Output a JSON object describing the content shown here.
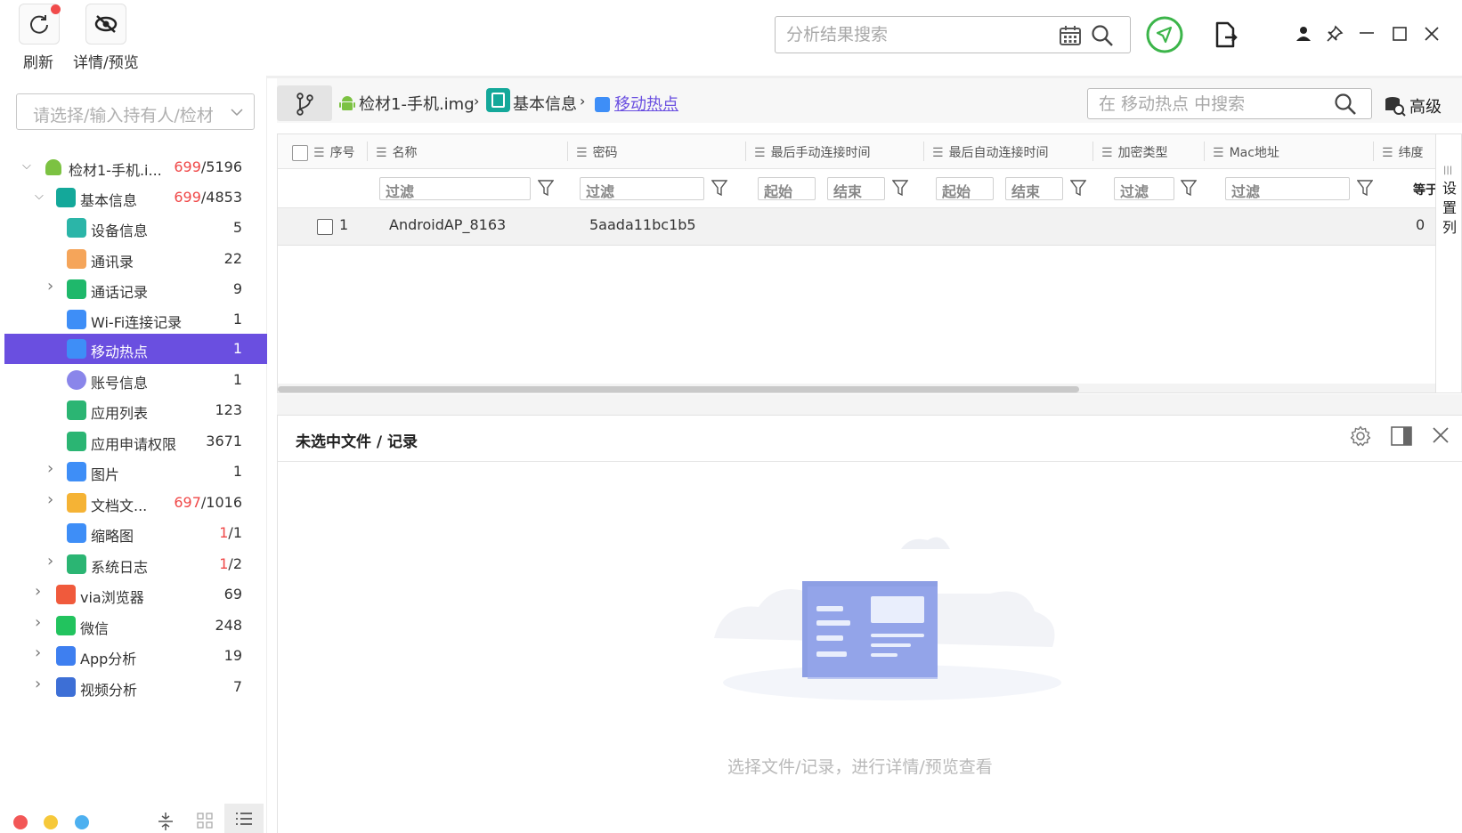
{
  "toolbar": {
    "refresh_label": "刷新",
    "detail_preview_label": "详情/预览",
    "search_placeholder": "分析结果搜索"
  },
  "left_panel": {
    "owner_placeholder": "请选择/输入持有人/检材",
    "tree": [
      {
        "label": "检材1-手机.i...",
        "count_red": "699",
        "count_rest": "/5196",
        "icon": "android-icon"
      },
      {
        "label": "基本信息",
        "count_red": "699",
        "count_rest": "/4853",
        "icon": "info-icon"
      },
      {
        "label": "设备信息",
        "count": "5",
        "icon": "device-icon"
      },
      {
        "label": "通讯录",
        "count": "22",
        "icon": "contacts-icon"
      },
      {
        "label": "通话记录",
        "count": "9",
        "icon": "phone-icon"
      },
      {
        "label": "Wi-Fi连接记录",
        "count": "1",
        "icon": "wifi-icon"
      },
      {
        "label": "移动热点",
        "count": "1",
        "icon": "hotspot-icon"
      },
      {
        "label": "账号信息",
        "count": "1",
        "icon": "account-icon"
      },
      {
        "label": "应用列表",
        "count": "123",
        "icon": "list-icon"
      },
      {
        "label": "应用申请权限",
        "count": "3671",
        "icon": "list-icon"
      },
      {
        "label": "图片",
        "count": "1",
        "icon": "image-icon"
      },
      {
        "label": "文档文...",
        "count_red": "697",
        "count_rest": "/1016",
        "icon": "document-icon"
      },
      {
        "label": "缩略图",
        "count_red": "1",
        "count_rest": "/1",
        "icon": "thumbnail-icon"
      },
      {
        "label": "系统日志",
        "count_red": "1",
        "count_rest": "/2",
        "icon": "log-icon"
      },
      {
        "label": "via浏览器",
        "count": "69",
        "icon": "browser-icon"
      },
      {
        "label": "微信",
        "count": "248",
        "icon": "wechat-icon"
      },
      {
        "label": "App分析",
        "count": "19",
        "icon": "app-analysis-icon"
      },
      {
        "label": "视频分析",
        "count": "7",
        "icon": "video-analysis-icon"
      }
    ]
  },
  "breadcrumb": {
    "items": [
      "检材1-手机.img",
      "基本信息",
      "移动热点"
    ],
    "search_placeholder": "在 移动热点 中搜索",
    "advanced_label": "高级"
  },
  "grid": {
    "columns": [
      "序号",
      "名称",
      "密码",
      "最后手动连接时间",
      "最后自动连接时间",
      "加密类型",
      "Mac地址",
      "纬度"
    ],
    "filter_label": "过滤",
    "start_label": "起始",
    "end_label": "结束",
    "equals_label": "等于",
    "settings_col_label": "设置列",
    "rows": [
      {
        "index": "1",
        "name": "AndroidAP_8163",
        "password": "5aada11bc1b5",
        "lat": "0"
      }
    ]
  },
  "detail": {
    "title": "未选中文件 / 记录",
    "empty_text": "选择文件/记录，进行详情/预览查看"
  },
  "colors": {
    "accent": "#6a4fe0",
    "red": "#f04848",
    "green": "#3cb54a"
  }
}
